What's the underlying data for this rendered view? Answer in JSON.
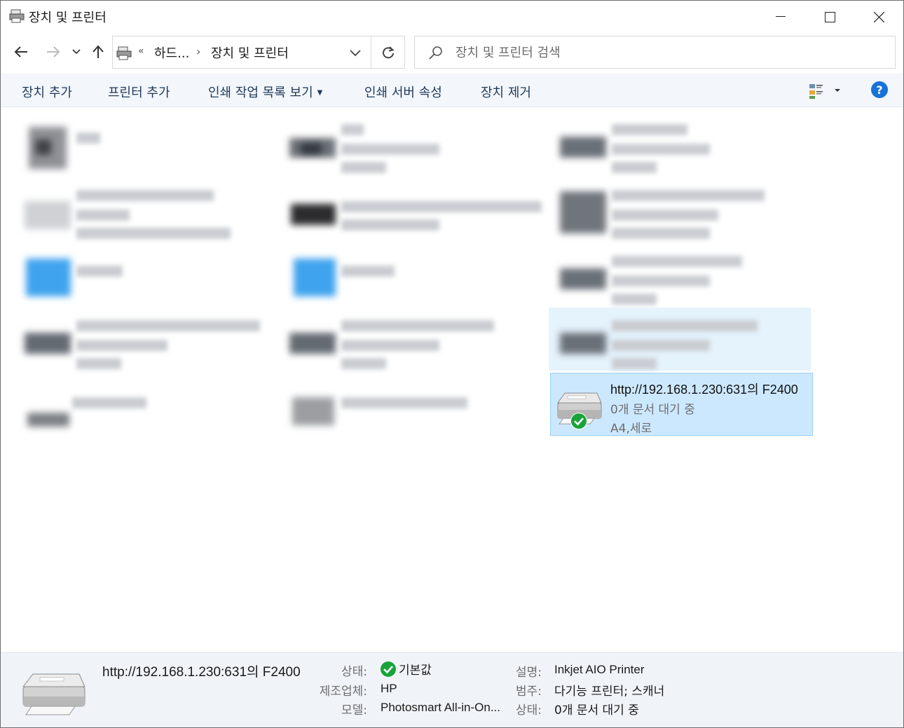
{
  "window": {
    "title": "장치 및 프린터"
  },
  "address": {
    "overflow_glyph": "«",
    "crumbs": [
      "하드...",
      "장치 및 프린터"
    ],
    "sep": "›"
  },
  "search": {
    "placeholder": "장치 및 프린터 검색"
  },
  "commands": {
    "add_device": "장치 추가",
    "add_printer": "프린터 추가",
    "print_queue": "인쇄 작업 목록 보기",
    "print_server": "인쇄 서버 속성",
    "remove_device": "장치 제거",
    "help": "?"
  },
  "selected_device": {
    "name": "http://192.168.1.230:631의 F2400",
    "queue": "0개 문서 대기 중",
    "paper": "A4,세로"
  },
  "details": {
    "name": "http://192.168.1.230:631의 F2400",
    "status_label": "상태:",
    "status_value": "기본값",
    "manufacturer_label": "제조업체:",
    "manufacturer_value": "HP",
    "model_label": "모델:",
    "model_value": "Photosmart All-in-On...",
    "description_label": "설명:",
    "description_value": "Inkjet AIO Printer",
    "category_label": "범주:",
    "category_value": "다기능 프린터; 스캐너",
    "queue_label": "상태:",
    "queue_value": "0개 문서 대기 중"
  },
  "colors": {
    "accent": "#1773d8",
    "selection": "#cce8ff",
    "selection_border": "#99d1ff",
    "default_check": "#19a33a"
  },
  "icons": [
    "printer-folder-icon",
    "back-arrow-icon",
    "forward-arrow-icon",
    "chevron-down-icon",
    "up-arrow-icon",
    "refresh-icon",
    "search-icon",
    "view-options-icon",
    "help-icon",
    "default-check-icon",
    "printer-icon"
  ]
}
